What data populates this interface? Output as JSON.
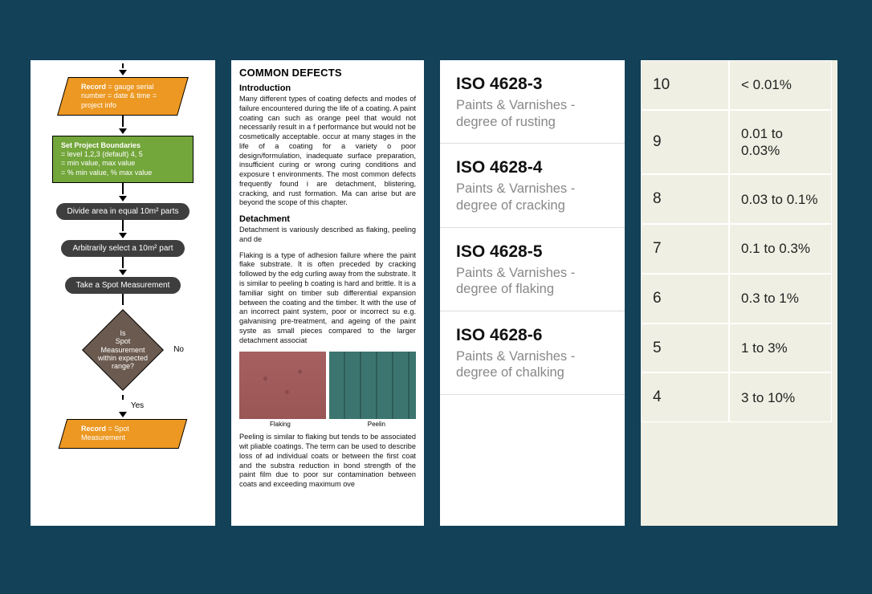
{
  "panel1": {
    "record1": {
      "title": "Record",
      "l1": "= gauge serial number",
      "l2": "= date & time",
      "l3": "= project info"
    },
    "set": {
      "title": "Set Project Boundaries",
      "l1": "= level 1,2,3 (default) 4, 5",
      "l2": "= min value,  max value",
      "l3": "= % min value, % max value"
    },
    "pill1": "Divide area in equal 10m² parts",
    "pill2": "Arbitrarily select a 10m² part",
    "pill3": "Take a Spot Measurement",
    "diamond": "Is\nSpot\nMeasurement\nwithin expected\nrange?",
    "no": "No",
    "yes": "Yes",
    "record2": {
      "title": "Record",
      "l1": "= Spot Measurement"
    }
  },
  "panel2": {
    "title": "COMMON DEFECTS",
    "intro_h": "Introduction",
    "intro_p": "Many different types of coating defects and modes of failure encountered during the life of a coating. A paint coating can such as orange peel that would not necessarily result in a f performance but would not be cosmetically acceptable. occur at many stages in the life of a coating for a variety o poor design/formulation, inadequate surface preparation, insufficient curing or wrong curing conditions and exposure t environments. The most common defects frequently found i are detachment, blistering, cracking, and rust formation. Ma can arise but are beyond the scope of this chapter.",
    "detach_h": "Detachment",
    "detach_p1": "Detachment is variously described as flaking, peeling and de",
    "detach_p2": "Flaking is a type of adhesion failure where the paint flake substrate. It is often preceded by cracking followed by the edg curling away from the substrate. It is similar to peeling b coating is hard and brittle. It is a familiar sight on timber sub differential expansion between the coating and the timber. It with the use of an incorrect paint system, poor or incorrect su e.g. galvanising pre-treatment, and ageing of the paint syste as small pieces compared to the larger detachment associat",
    "cap_a": "Flaking",
    "cap_b": "Peelin",
    "detach_p3": "Peeling is similar to flaking but tends to be associated wit pliable coatings. The term can be used to describe loss of ad individual coats or between the first coat and the substra reduction in bond strength of the paint film due to poor sur contamination between coats and exceeding maximum ove"
  },
  "panel3": [
    {
      "title": "ISO 4628-3",
      "sub": "Paints & Varnishes - degree of rusting"
    },
    {
      "title": "ISO 4628-4",
      "sub": "Paints & Varnishes - degree of cracking"
    },
    {
      "title": "ISO 4628-5",
      "sub": "Paints & Varnishes - degree of flaking"
    },
    {
      "title": "ISO 4628-6",
      "sub": "Paints & Varnishes - degree of chalking"
    }
  ],
  "panel4": [
    {
      "r": "10",
      "v": "< 0.01%"
    },
    {
      "r": "9",
      "v": "0.01 to 0.03%"
    },
    {
      "r": "8",
      "v": "0.03 to 0.1%"
    },
    {
      "r": "7",
      "v": "0.1 to 0.3%"
    },
    {
      "r": "6",
      "v": "0.3 to 1%"
    },
    {
      "r": "5",
      "v": "1 to 3%"
    },
    {
      "r": "4",
      "v": "3 to 10%"
    }
  ]
}
